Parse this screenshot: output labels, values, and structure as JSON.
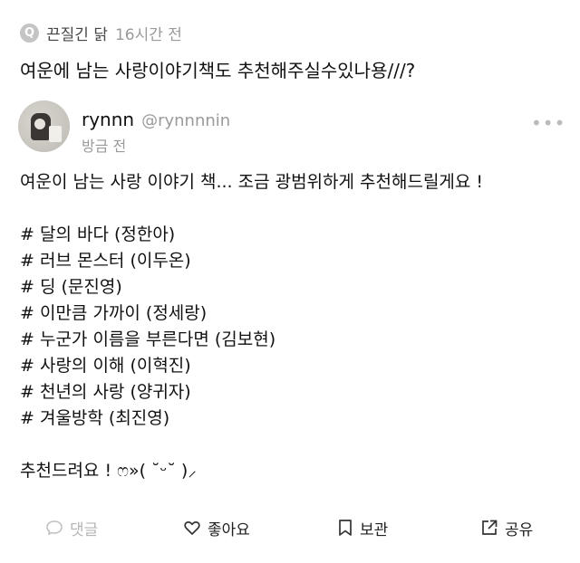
{
  "question": {
    "badge": "Q",
    "author": "끈질긴 닭",
    "time": "16시간 전",
    "title": "여운에 남는 사랑이야기책도 추천해주실수있나용///?"
  },
  "answer": {
    "username": "rynnn",
    "handle": "@rynnnnin",
    "time": "방금 전",
    "more": "•••",
    "intro": "여운이 남는 사랑 이야기 책... 조금 광범위하게 추천해드릴게요 !",
    "books": [
      "# 달의 바다 (정한아)",
      "# 러브 몬스터 (이두온)",
      "# 딩 (문진영)",
      "# 이만큼 가까이 (정세랑)",
      "# 누군가 이름을 부른다면 (김보현)",
      "# 사랑의 이해 (이혁진)",
      "# 천년의 사랑 (양귀자)",
      "# 겨울방학 (최진영)"
    ],
    "outro": "추천드려요 ! ෆ»( ˘ᵕ˘ )⸝"
  },
  "actions": {
    "comment": "댓글",
    "like": "좋아요",
    "save": "보관",
    "share": "공유"
  }
}
